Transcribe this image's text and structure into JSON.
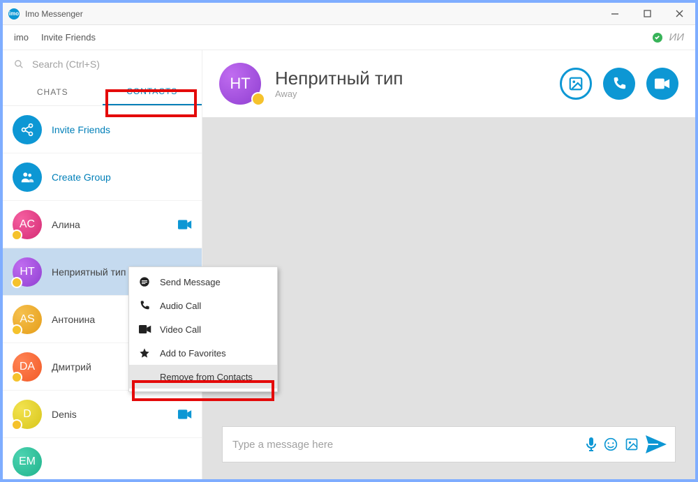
{
  "window": {
    "title": "Imo Messenger"
  },
  "topmenu": {
    "imo": "imo",
    "invite": "Invite Friends",
    "initials": "ИИ"
  },
  "search": {
    "placeholder": "Search (Ctrl+S)"
  },
  "tabs": {
    "chats": "CHATS",
    "contacts": "CONTACTS"
  },
  "sidebar": {
    "invite_friends": "Invite Friends",
    "create_group": "Create Group",
    "contacts": [
      {
        "initials": "AC",
        "name": "Алина",
        "grad": "grad-pink"
      },
      {
        "initials": "HT",
        "name": "Неприятный тип",
        "grad": "grad-purple"
      },
      {
        "initials": "AS",
        "name": "Антонина",
        "grad": "grad-yellow"
      },
      {
        "initials": "DA",
        "name": "Дмитрий",
        "grad": "grad-orange"
      },
      {
        "initials": "D",
        "name": "Denis",
        "grad": "grad-lime"
      },
      {
        "initials": "EM",
        "name": "",
        "grad": "grad-teal"
      }
    ]
  },
  "context_menu": {
    "items": [
      {
        "label": "Send Message"
      },
      {
        "label": "Audio Call"
      },
      {
        "label": "Video Call"
      },
      {
        "label": "Add to Favorites"
      },
      {
        "label": "Remove from Contacts"
      }
    ]
  },
  "main": {
    "title": "Непритный тип",
    "status": "Away",
    "avatar_initials": "HT"
  },
  "composer": {
    "placeholder": "Type a message here"
  },
  "colors": {
    "accent": "#0d97d4",
    "highlight": "#e40a0a"
  }
}
